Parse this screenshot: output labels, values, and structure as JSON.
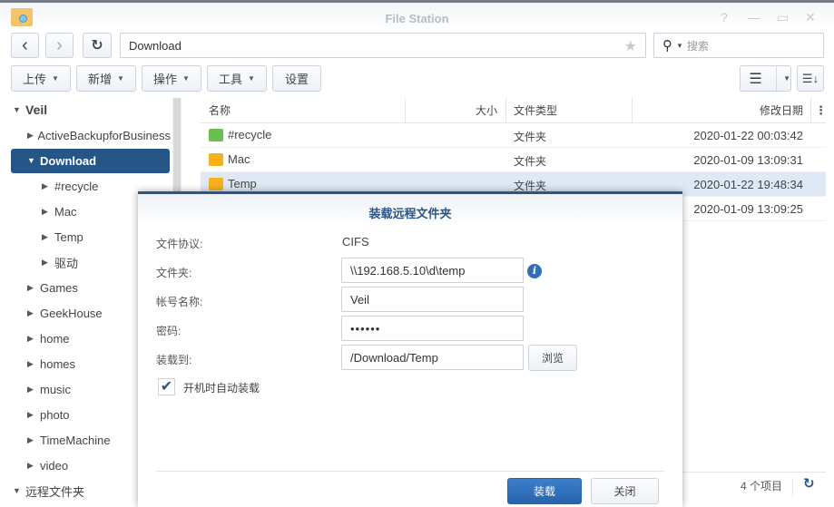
{
  "window": {
    "title": "File Station",
    "help": "?",
    "minimize": "—",
    "maximize": "▭",
    "close": "✕"
  },
  "nav": {
    "back": "‹",
    "forward": "›",
    "refresh": "↻",
    "path": "Download",
    "star": "★",
    "search_placeholder": "搜索"
  },
  "toolbar": {
    "upload": "上传",
    "create": "新增",
    "action": "操作",
    "tools": "工具",
    "settings": "设置"
  },
  "sidebar": {
    "root": "Veil",
    "items": [
      {
        "label": "ActiveBackupforBusiness",
        "level": 1,
        "expanded": false
      },
      {
        "label": "Download",
        "level": 1,
        "expanded": true,
        "selected": true
      },
      {
        "label": "#recycle",
        "level": 2
      },
      {
        "label": "Mac",
        "level": 2
      },
      {
        "label": "Temp",
        "level": 2
      },
      {
        "label": "驱动",
        "level": 2
      },
      {
        "label": "Games",
        "level": 1
      },
      {
        "label": "GeekHouse",
        "level": 1
      },
      {
        "label": "home",
        "level": 1
      },
      {
        "label": "homes",
        "level": 1
      },
      {
        "label": "music",
        "level": 1
      },
      {
        "label": "photo",
        "level": 1
      },
      {
        "label": "TimeMachine",
        "level": 1
      },
      {
        "label": "video",
        "level": 1
      }
    ],
    "remote": "远程文件夹"
  },
  "table": {
    "headers": {
      "name": "名称",
      "size": "大小",
      "type": "文件类型",
      "date": "修改日期"
    },
    "rows": [
      {
        "name": "#recycle",
        "type": "文件夹",
        "date": "2020-01-22 00:03:42",
        "icon": "recycle-bin"
      },
      {
        "name": "Mac",
        "type": "文件夹",
        "date": "2020-01-09 13:09:31",
        "icon": "folder"
      },
      {
        "name": "Temp",
        "type": "文件夹",
        "date": "2020-01-22 19:48:34",
        "icon": "remote-folder"
      },
      {
        "name": "",
        "type": "",
        "date": "2020-01-09 13:09:25",
        "icon": "folder"
      }
    ]
  },
  "status": {
    "count": "4 个项目"
  },
  "dialog": {
    "title": "装载远程文件夹",
    "protocol_label": "文件协议:",
    "protocol": "CIFS",
    "folder_label": "文件夹:",
    "folder": "\\\\192.168.5.10\\d\\temp",
    "account_label": "帐号名称:",
    "account": "Veil",
    "password_label": "密码:",
    "password": "••••••",
    "mount_label": "装载到:",
    "mount": "/Download/Temp",
    "browse": "浏览",
    "auto_mount": "开机时自动装载",
    "auto_mount_checked": true,
    "ok": "装载",
    "close": "关闭"
  },
  "colors": {
    "accent": "#255687",
    "primary_button": "#2e6fb8"
  }
}
